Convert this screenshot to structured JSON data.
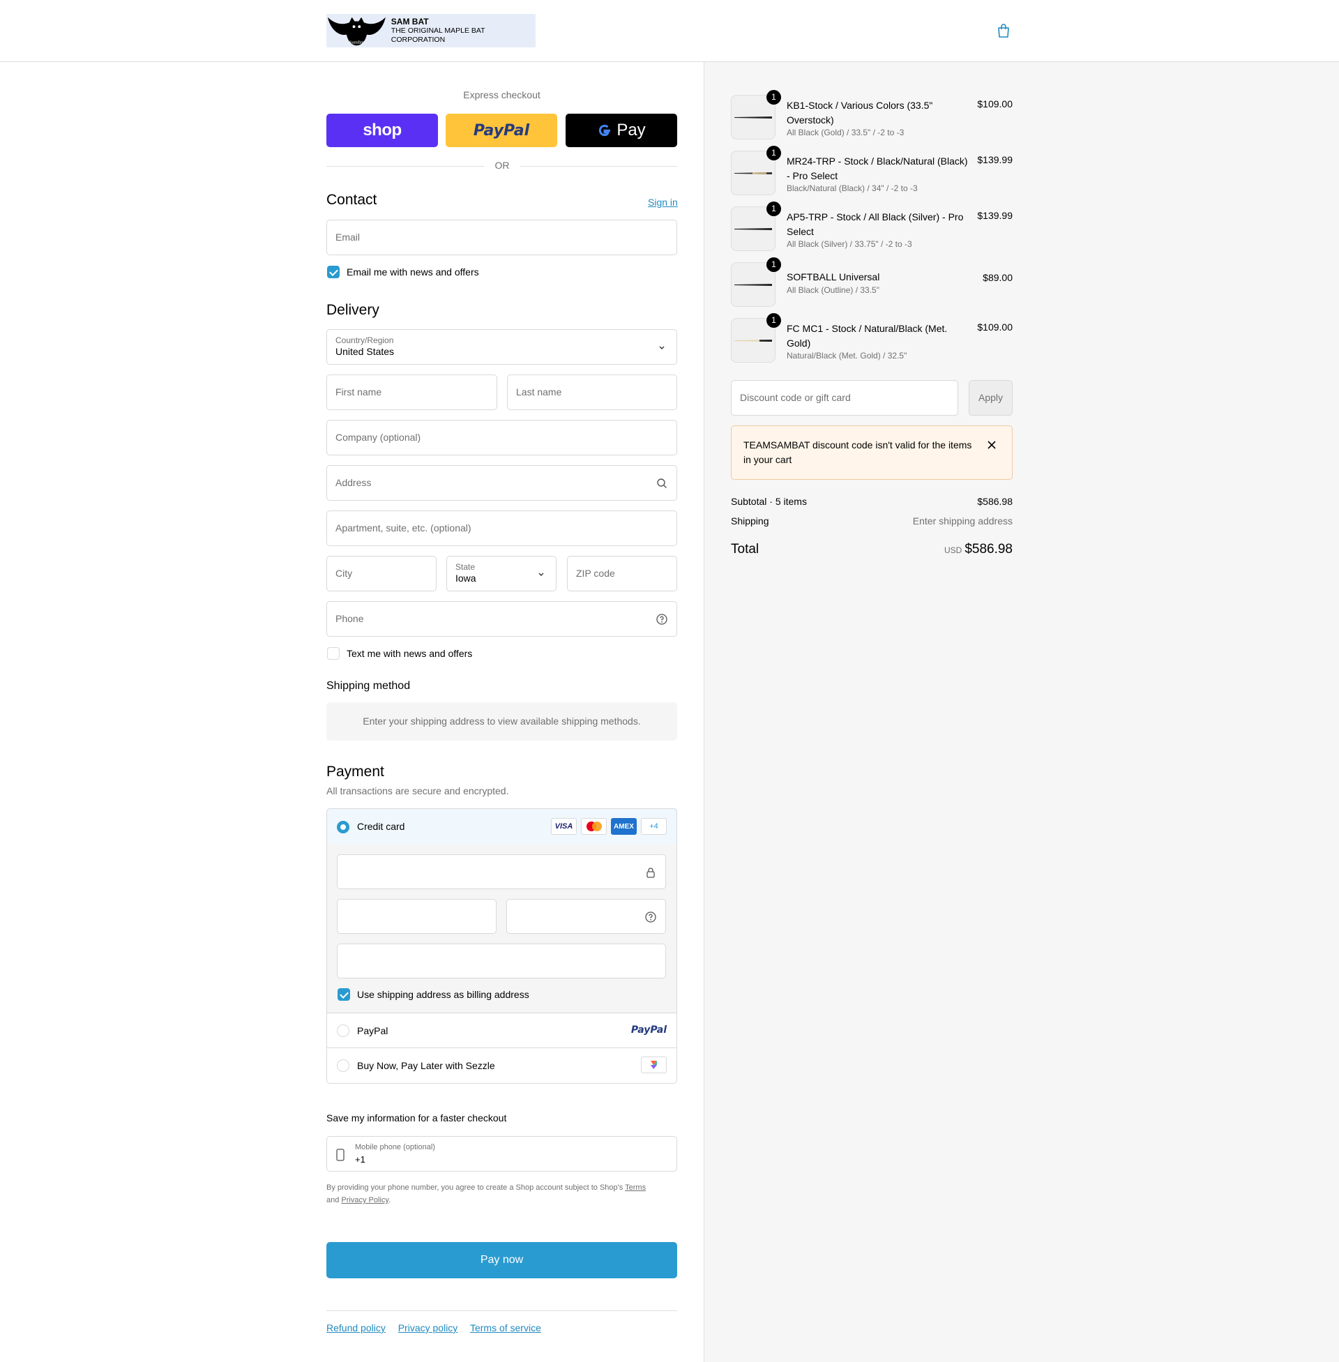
{
  "header": {
    "brand_name": "SAM BAT",
    "brand_tagline": "THE ORIGINAL MAPLE BAT CORPORATION",
    "logo_script": "SamBat"
  },
  "express": {
    "label": "Express checkout",
    "shop_label": "shop",
    "paypal_label": "PayPal",
    "gpay_label": "Pay",
    "or": "OR"
  },
  "contact": {
    "title": "Contact",
    "sign_in": "Sign in",
    "email_placeholder": "Email",
    "news_label": "Email me with news and offers",
    "news_checked": true
  },
  "delivery": {
    "title": "Delivery",
    "country_label": "Country/Region",
    "country_value": "United States",
    "first_name": "First name",
    "last_name": "Last name",
    "company": "Company (optional)",
    "address": "Address",
    "apartment": "Apartment, suite, etc. (optional)",
    "city": "City",
    "state_label": "State",
    "state_value": "Iowa",
    "zip": "ZIP code",
    "phone": "Phone",
    "text_label": "Text me with news and offers",
    "text_checked": false
  },
  "shipping": {
    "title": "Shipping method",
    "message": "Enter your shipping address to view available shipping methods."
  },
  "payment": {
    "title": "Payment",
    "subtitle": "All transactions are secure and encrypted.",
    "credit_card": "Credit card",
    "card_logos": [
      "VISA",
      "mastercard",
      "AMEX",
      "+4"
    ],
    "billing_label": "Use shipping address as billing address",
    "billing_checked": true,
    "paypal": "PayPal",
    "paypal_logo": "PayPal",
    "sezzle": "Buy Now, Pay Later with Sezzle"
  },
  "save_info": {
    "title": "Save my information for a faster checkout",
    "mobile_label": "Mobile phone (optional)",
    "mobile_value": "+1",
    "legal_prefix": "By providing your phone number, you agree to create a Shop account subject to Shop's",
    "terms": "Terms",
    "and": "and",
    "privacy": "Privacy Policy",
    "period": "."
  },
  "pay_now": "Pay now",
  "footer": {
    "refund": "Refund policy",
    "privacy": "Privacy policy",
    "terms": "Terms of service"
  },
  "summary": {
    "items": [
      {
        "qty": "1",
        "name": "KB1-Stock / Various Colors (33.5\" Overstock)",
        "variant": "All Black (Gold) / 33.5\" / -2 to -3",
        "price": "$109.00"
      },
      {
        "qty": "1",
        "name": "MR24-TRP - Stock / Black/Natural (Black) - Pro Select",
        "variant": "Black/Natural (Black) / 34\" / -2 to -3",
        "price": "$139.99"
      },
      {
        "qty": "1",
        "name": "AP5-TRP - Stock / All Black (Silver) - Pro Select",
        "variant": "All Black (Silver) / 33.75\" / -2 to -3",
        "price": "$139.99"
      },
      {
        "qty": "1",
        "name": "SOFTBALL Universal",
        "variant": "All Black (Outline) / 33.5\"",
        "price": "$89.00"
      },
      {
        "qty": "1",
        "name": "FC MC1 - Stock / Natural/Black (Met. Gold)",
        "variant": "Natural/Black (Met. Gold) / 32.5\"",
        "price": "$109.00"
      }
    ],
    "discount_placeholder": "Discount code or gift card",
    "apply": "Apply",
    "notice": "TEAMSAMBAT discount code isn't valid for the items in your cart",
    "subtotal_label": "Subtotal · 5 items",
    "subtotal_value": "$586.98",
    "shipping_label": "Shipping",
    "shipping_value": "Enter shipping address",
    "total_label": "Total",
    "currency": "USD",
    "total_value": "$586.98"
  },
  "colors": {
    "accent": "#2a9bd0",
    "shop": "#5a31f4",
    "paypal": "#ffc439",
    "notice_bg": "#fff5ea"
  }
}
